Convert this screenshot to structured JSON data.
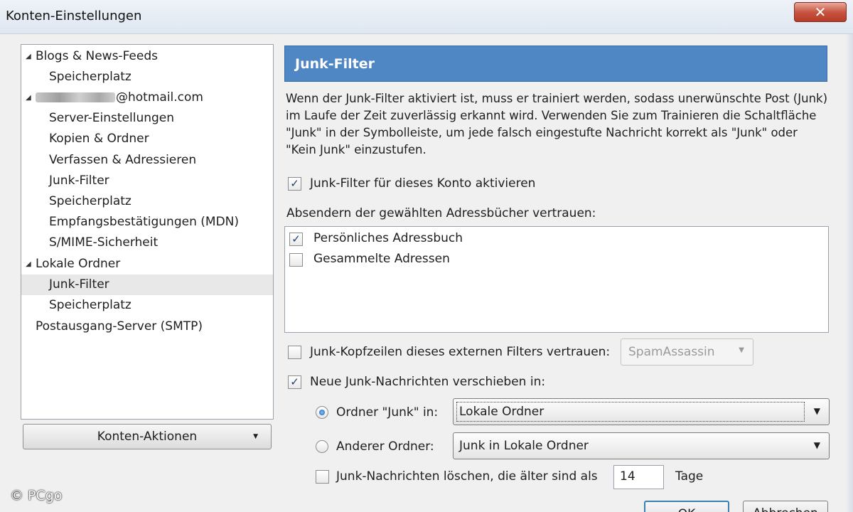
{
  "window": {
    "title": "Konten-Einstellungen",
    "close_glyph": "✕"
  },
  "tree": {
    "items": [
      {
        "label": "Blogs & News-Feeds",
        "level": 0,
        "expanded": true
      },
      {
        "label": "Speicherplatz",
        "level": 1
      },
      {
        "label": "@hotmail.com",
        "level": 0,
        "expanded": true,
        "blurred_prefix": true
      },
      {
        "label": "Server-Einstellungen",
        "level": 1
      },
      {
        "label": "Kopien & Ordner",
        "level": 1
      },
      {
        "label": "Verfassen & Adressieren",
        "level": 1
      },
      {
        "label": "Junk-Filter",
        "level": 1
      },
      {
        "label": "Speicherplatz",
        "level": 1
      },
      {
        "label": "Empfangsbestätigungen (MDN)",
        "level": 1
      },
      {
        "label": "S/MIME-Sicherheit",
        "level": 1
      },
      {
        "label": "Lokale Ordner",
        "level": 0,
        "expanded": true
      },
      {
        "label": "Junk-Filter",
        "level": 1,
        "selected": true
      },
      {
        "label": "Speicherplatz",
        "level": 1
      },
      {
        "label": "Postausgang-Server (SMTP)",
        "level": 0
      }
    ],
    "expand_glyph": "◢"
  },
  "account_actions": {
    "label": "Konten-Aktionen",
    "arrow": "▼"
  },
  "panel": {
    "heading": "Junk-Filter",
    "description": "Wenn der Junk-Filter aktiviert ist, muss er trainiert werden, sodass unerwünschte Post (Junk) im Laufe der Zeit zuverlässig erkannt wird. Verwenden Sie zum Trainieren die Schaltfläche \"Junk\" in der Symbolleiste, um jede falsch eingestufte Nachricht korrekt als \"Junk\" oder \"Kein Junk\" einzustufen.",
    "enable_filter": {
      "label": "Junk-Filter für dieses Konto aktivieren",
      "checked": true
    },
    "trust_label": "Absendern der gewählten Adressbücher vertrauen:",
    "addressbooks": [
      {
        "label": "Persönliches Adressbuch",
        "checked": true
      },
      {
        "label": "Gesammelte Adressen",
        "checked": false
      }
    ],
    "trust_headers": {
      "label": "Junk-Kopfzeilen dieses externen Filters vertrauen:",
      "checked": false,
      "select_value": "SpamAssassin"
    },
    "move_junk": {
      "label": "Neue Junk-Nachrichten verschieben in:",
      "checked": true
    },
    "folder_junk": {
      "label": "Ordner \"Junk\" in:",
      "selected": true,
      "value": "Lokale Ordner"
    },
    "other_folder": {
      "label": "Anderer Ordner:",
      "selected": false,
      "value": "Junk in Lokale Ordner"
    },
    "delete_old": {
      "label": "Junk-Nachrichten löschen, die älter sind als",
      "checked": false,
      "days": "14",
      "unit": "Tage"
    }
  },
  "buttons": {
    "ok": "OK",
    "cancel": "Abbrechen"
  },
  "watermark": "© PCgo",
  "check_glyph": "✓",
  "colors": {
    "header_bg": "#4f86c4",
    "selection_bg": "#e8e8e8",
    "close_bg": "#c85540"
  }
}
